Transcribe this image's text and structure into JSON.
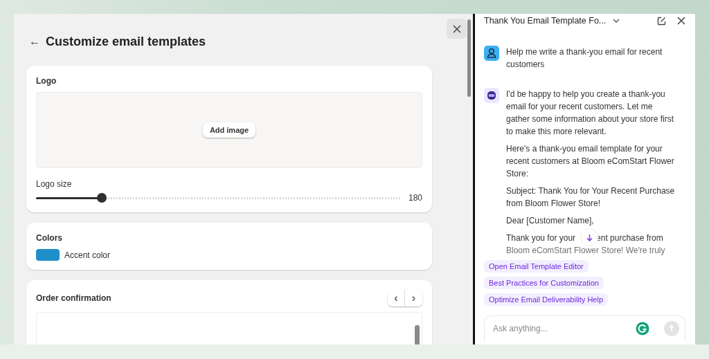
{
  "editor": {
    "back_label": "←",
    "title": "Customize email templates",
    "logo_card": {
      "heading": "Logo",
      "add_button": "Add image",
      "size_label": "Logo size",
      "size": {
        "level": 0.18,
        "reading": "180"
      }
    },
    "colors_card": {
      "heading": "Colors",
      "swatches": [
        {
          "label": "Accent color",
          "color": "#1f8fc9"
        }
      ]
    },
    "order_card": {
      "heading": "Order confirmation",
      "prev": "‹",
      "next": "›"
    }
  },
  "chat": {
    "title": "Thank You Email Template Fo...",
    "messages": [
      {
        "kind": "user",
        "paragraphs": [
          {
            "kind": "text",
            "text": "Help me write a thank-you email for recent customers"
          }
        ]
      },
      {
        "kind": "assistant",
        "paragraphs": [
          {
            "kind": "text",
            "text": "I'd be happy to help you create a thank-you email for your recent customers. Let me gather some information about your store first to make this more relevant."
          },
          {
            "kind": "text",
            "text": "Here's a thank-you email template for your recent customers at Bloom eComStart Flower Store:"
          },
          {
            "kind": "text",
            "text": "Subject: Thank You for Your Recent Purchase from Bloom Flower Store!"
          },
          {
            "kind": "text",
            "text": "Dear [Customer Name],"
          },
          {
            "kind": "covered",
            "before": "Thank you for your",
            "after": "ent purchase from",
            "next": "Bloom eComStart Flower Store! We're truly"
          }
        ]
      }
    ],
    "suggestions": [
      "Open Email Template Editor",
      "Best Practices for Customization",
      "Optimize Email Deliverability Help"
    ],
    "input": {
      "placeholder": "Ask anything..."
    }
  }
}
